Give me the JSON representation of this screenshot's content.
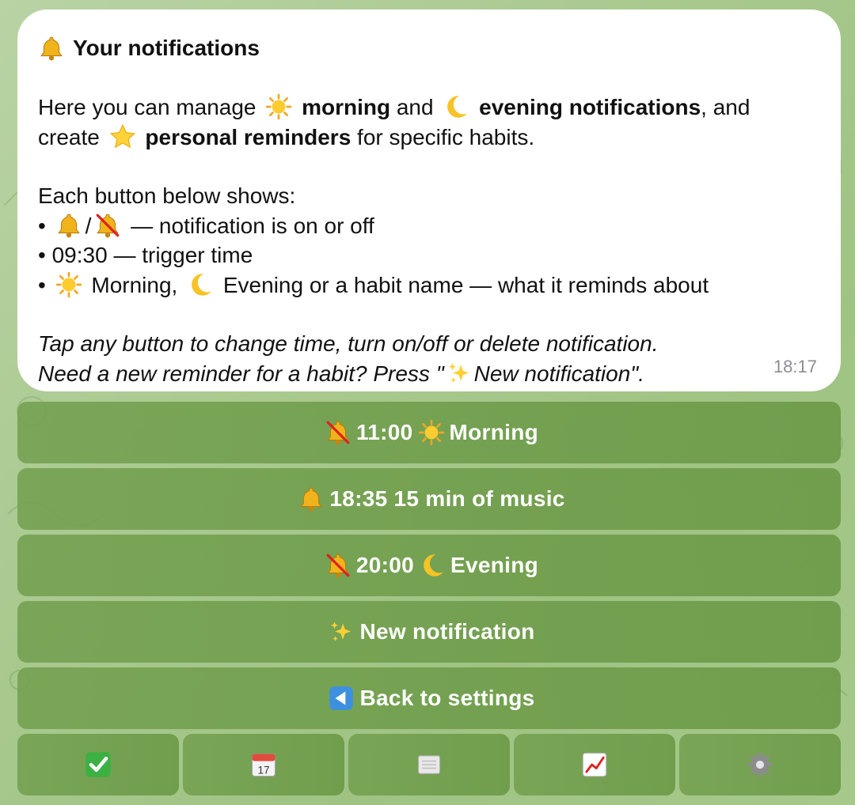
{
  "message": {
    "title": "Your notifications",
    "intro_1": "Here you can manage",
    "morning_bold": "morning",
    "and_1": "and",
    "evening_bold": "evening notifications",
    "and_2": ", and",
    "create": "create",
    "personal_bold": "personal reminders",
    "for_habits": "for specific habits.",
    "each_button": "Each button below shows:",
    "bullet_1_slash": "/",
    "bullet_1_text": "— notification is on or off",
    "bullet_2_text": "09:30 — trigger time",
    "bullet_3_morning": "Morning,",
    "bullet_3_text": "Evening or a habit name — what it reminds about",
    "tap_line": "Tap any button to change time, turn on/off or delete notification.",
    "need_line_start": "Need a new reminder for a habit? Press \"",
    "need_line_end": "New notification\".",
    "time": "18:17"
  },
  "buttons": [
    {
      "time": "11:00",
      "label": "Morning",
      "status_icon": "bell-off-icon",
      "type_icon": "sun-icon"
    },
    {
      "time": "18:35",
      "label": "15 min of music",
      "status_icon": "bell-icon",
      "type_icon": ""
    },
    {
      "time": "20:00",
      "label": "Evening",
      "status_icon": "bell-off-icon",
      "type_icon": "moon-icon"
    }
  ],
  "new_notification": {
    "label": "New notification",
    "icon": "sparkles-icon"
  },
  "back": {
    "label": "Back to settings",
    "icon": "back-arrow-icon"
  },
  "bottom_bar": [
    {
      "icon": "check-icon"
    },
    {
      "icon": "calendar-icon",
      "text": "17"
    },
    {
      "icon": "notebook-icon"
    },
    {
      "icon": "chart-icon"
    },
    {
      "icon": "gear-icon"
    }
  ]
}
